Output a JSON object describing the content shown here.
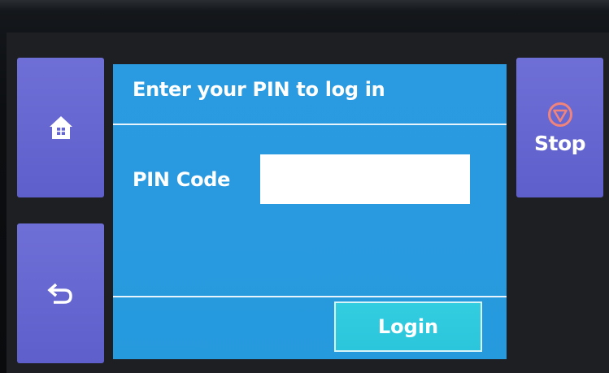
{
  "panel": {
    "title": "Enter your PIN to log in",
    "pin_label": "PIN Code",
    "pin_value": "",
    "pin_placeholder": "",
    "login_label": "Login"
  },
  "sidebar": {
    "home_icon": "home-icon",
    "back_icon": "back-arrow-icon",
    "stop_icon": "stop-icon",
    "stop_label": "Stop"
  },
  "colors": {
    "panel_bg": "#2a9be0",
    "side_button_bg": "#6565cf",
    "login_button_bg": "#30cadf",
    "stop_icon_color": "#f0837a"
  }
}
